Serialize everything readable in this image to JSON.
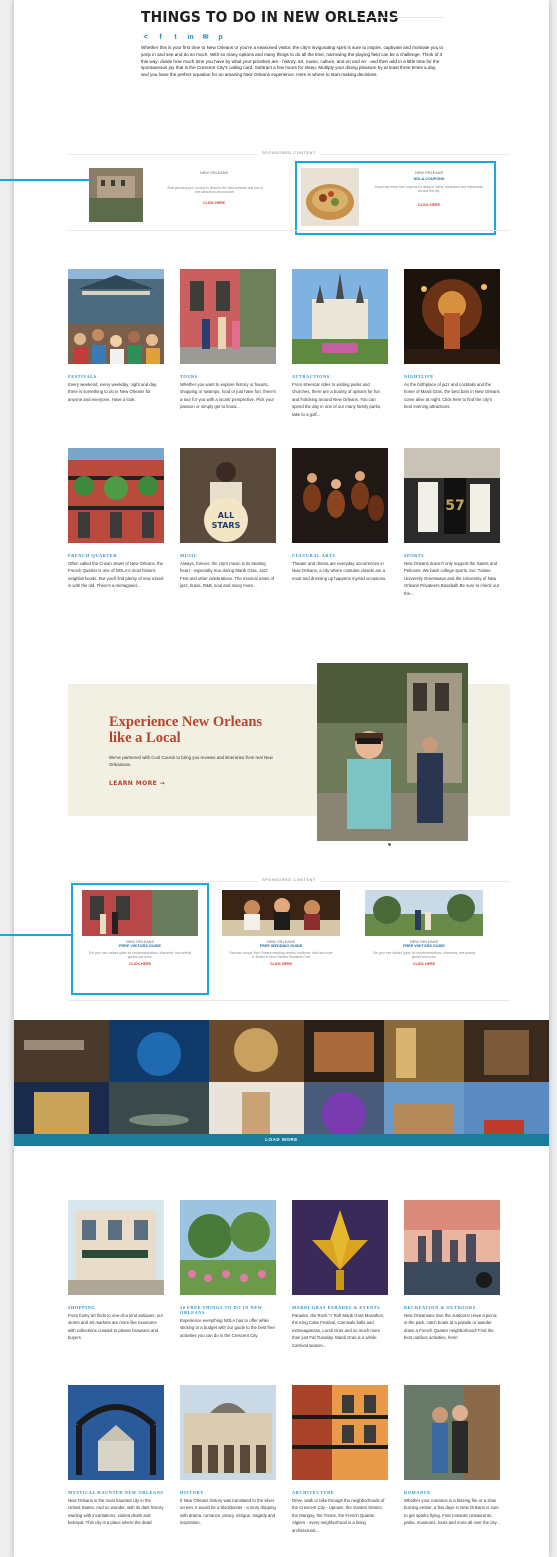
{
  "header": {
    "title": "THINGS TO DO IN NEW ORLEANS",
    "share_icons": [
      "share-icon",
      "facebook-icon",
      "twitter-icon",
      "linkedin-icon",
      "email-icon",
      "pinterest-icon"
    ],
    "intro": "Whether this is your first time to New Orleans or you're a seasoned visitor, the city's invigorating spirit is sure to inspire, captivate and motivate you to jump in and see and do so much. With so many options and many things to do all the time, narrowing the playing field can be a challenge. Think of it this way: divide how much time you have by what your priorities are - history, art, music, culture, and on and on - and then add in a little time for the spontaneous joy that is the Crescent City's calling card. Subtract a few hours for sleep. Multiply your dining pleasure by at least three times a day, and you have the perfect equation for an amazing New Orleans experience. Here is where to start making decisions."
  },
  "sponsored_top": {
    "label": "SPONSORED CONTENT",
    "ads": [
      {
        "kicker": "NEW ORLEANS",
        "title": "",
        "desc": "Start planning your no-fuss to discover the best activities and sun to see attractions around town.",
        "cta": "CLICK HERE"
      },
      {
        "kicker": "NEW ORLEANS",
        "title": "NOLA COUPONS",
        "desc": "Download these free coupons for deals of hotels, attractions and restaurants around the city.",
        "cta": "CLICK HERE"
      }
    ]
  },
  "tiles_row1": [
    {
      "cat": "FESTIVALS",
      "desc": "Every weekend, every weekday, night and day, there is something to do in New Orleans for anyone and everyone. Have a look."
    },
    {
      "cat": "TOURS",
      "desc": "Whether you want to explore history or haunts, shopping or swamps, food or just have fun, there's a tour for you with a locals' perspective. Pick your passion or simply get to know..."
    },
    {
      "cat": "ATTRACTIONS",
      "desc": "From streetcar rides to visiting parks and churches, there are a bounty of options for fun and frolicking around New Orleans. You can spend the day in one of our many family parks, take to a golf..."
    },
    {
      "cat": "NIGHTLIFE",
      "desc": "As the birthplace of jazz and cocktails and the home of Mardi Gras, the best bars in New Orleans come alive at night. Click here to find the city's best evening attractions."
    }
  ],
  "tiles_row2": [
    {
      "cat": "FRENCH QUARTER",
      "desc": "Often called the Crown Jewel of New Orleans, the French Quarter is one of NOLA's most historic neighborhoods. But you'll find plenty of new mixed in with the old. There's a reimagined..."
    },
    {
      "cat": "MUSIC",
      "desc": "Always, forever, the city's music is its beating heart - especially true during Mardi Gras, Jazz Fest and other celebrations. The musical notes of jazz, brass, R&B, soul and many more..."
    },
    {
      "cat": "CULTURAL ARTS",
      "desc": "Theater and drama are everyday occurrences in New Orleans, a city where costume closets are a must and dressing up happens myriad occasions."
    },
    {
      "cat": "SPORTS",
      "desc": "New Orleans doesn't only support the Saints and Pelicans. We back college sports, too: Tulane University Greenwave and the University of New Orleans Privateers Baseball! Be sure to check out the..."
    }
  ],
  "experience": {
    "title_line1": "Experience New Orleans",
    "title_line2": "like a Local",
    "sub": "We've partnered with Cool Cousin to bring you reviews and itineraries from real New Orleanians.",
    "learn_more": "LEARN MORE →"
  },
  "sponsored_mid": {
    "label": "SPONSORED CONTENT",
    "ads": [
      {
        "kicker": "NEW ORLEANS",
        "title": "FREE VISITORS GUIDE",
        "desc": "Get your free visitors guide for recommendations, itineraries, free activity guides and tours.",
        "cta": "CLICK HERE"
      },
      {
        "kicker": "NEW ORLEANS",
        "title": "FREE WEDDING GUIDE",
        "desc": "Discover unique New Orleans wedding venues, traditions, food and more in 'Brides in New Orleans' Romantic Chef",
        "cta": "CLICK HERE"
      },
      {
        "kicker": "NEW ORLEANS",
        "title": "FREE VISITORS GUIDE",
        "desc": "Get your free visitors guide for recommendations, itineraries, free activity guides and tours.",
        "cta": "CLICK HERE"
      }
    ]
  },
  "gallery": {
    "load_more": "LOAD MORE"
  },
  "tiles_row3": [
    {
      "cat": "SHOPPING",
      "desc": "From funky art finds to one-of-a kind antiques, our stores and art markets are more like museums with collections curated to please browsers and buyers."
    },
    {
      "cat": "50 FREE THINGS TO DO IN NEW ORLEANS",
      "desc": "Experience everything NOLA has to offer while sticking to a budget with our guide to the best free activities you can do in the Crescent City."
    },
    {
      "cat": "MARDI GRAS PARADES & EVENTS",
      "desc": "Parades, the Rock 'n' Roll Mardi Gras Marathon, the King Cake Festival, Carnivals balls and extravaganzas, Lundi Gras and so much more than just Fat Tuesday. Mardi Gras is a whole Carnival season..."
    },
    {
      "cat": "RECREATION & OUTDOORS",
      "desc": "New Orleanians love the outdoors! Have a picnic in the park, catch boats at a parade or wander down a French Quarter neighborhood! Find the best outdoor activities, here!"
    }
  ],
  "tiles_row4": [
    {
      "cat": "MYSTICAL HAUNTED NEW ORLEANS",
      "desc": "New Orleans is the most haunted city in the United States. And no wonder, with its dark history swirling with incantations, violent death and betrayal. This city is a place where the dead"
    },
    {
      "cat": "HISTORY",
      "desc": "If New Orleans history was translated to the silver screen, it would be a blockbuster - a story dripping with drama, romance, piracy, intrigue, tragedy and inspiration."
    },
    {
      "cat": "ARCHITECTURE",
      "desc": "Drive, walk or bike through the neighborhoods of the Crescent City - Uptown, the Garden District, the Marigny, the Treme, the French Quarter, Algiers - every neighborhood is a living architectural..."
    },
    {
      "cat": "ROMANCE",
      "desc": "Whether your romance is a blazing fire or a slow burning ember, a few days in New Orleans is sure to get sparks flying. Find romantic restaurants, parks, museums, tours and more all over the city..."
    }
  ],
  "colors": {
    "accent": "#1aa7df",
    "category": "#2b8fbf",
    "cta": "#d23a2a",
    "experience": "#b5452c",
    "loadbar": "#1b7d9a"
  }
}
